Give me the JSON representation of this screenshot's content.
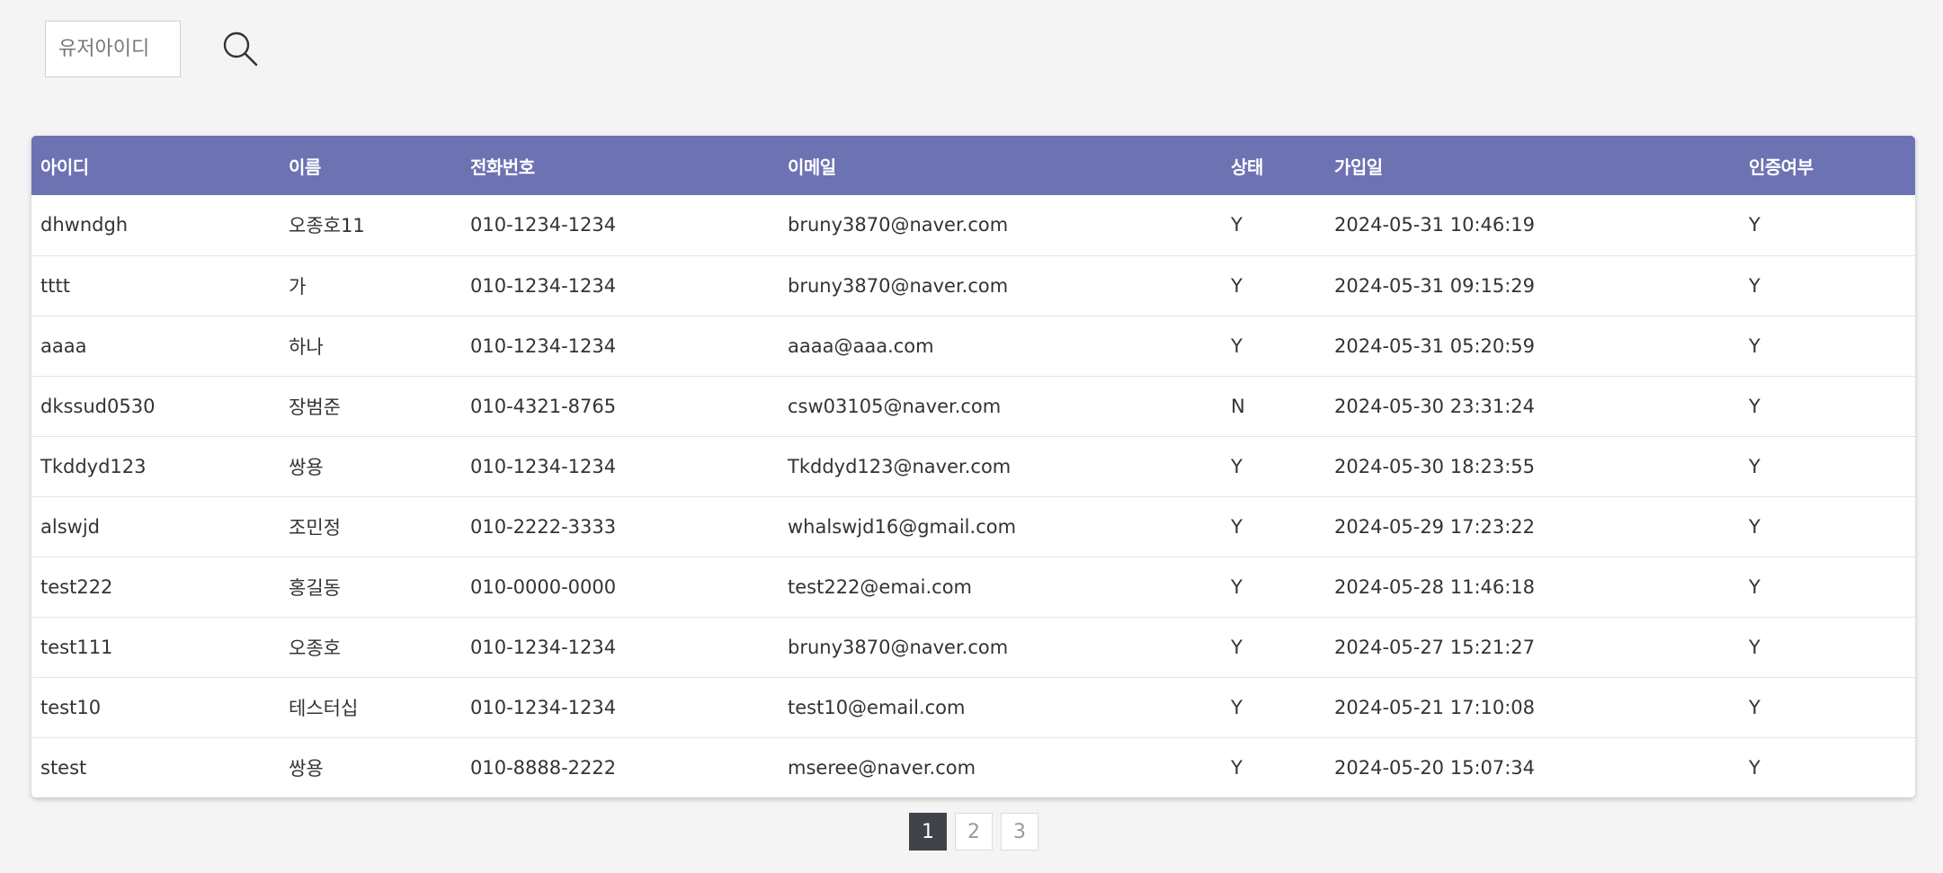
{
  "search": {
    "placeholder": "유저아이디",
    "value": ""
  },
  "table": {
    "headers": [
      "아이디",
      "이름",
      "전화번호",
      "이메일",
      "상태",
      "가입일",
      "인증여부"
    ],
    "rows": [
      [
        "dhwndgh",
        "오종호11",
        "010-1234-1234",
        "bruny3870@naver.com",
        "Y",
        "2024-05-31 10:46:19",
        "Y"
      ],
      [
        "tttt",
        "가",
        "010-1234-1234",
        "bruny3870@naver.com",
        "Y",
        "2024-05-31 09:15:29",
        "Y"
      ],
      [
        "aaaa",
        "하나",
        "010-1234-1234",
        "aaaa@aaa.com",
        "Y",
        "2024-05-31 05:20:59",
        "Y"
      ],
      [
        "dkssud0530",
        "장범준",
        "010-4321-8765",
        "csw03105@naver.com",
        "N",
        "2024-05-30 23:31:24",
        "Y"
      ],
      [
        "Tkddyd123",
        "쌍용",
        "010-1234-1234",
        "Tkddyd123@naver.com",
        "Y",
        "2024-05-30 18:23:55",
        "Y"
      ],
      [
        "alswjd",
        "조민정",
        "010-2222-3333",
        "whalswjd16@gmail.com",
        "Y",
        "2024-05-29 17:23:22",
        "Y"
      ],
      [
        "test222",
        "홍길동",
        "010-0000-0000",
        "test222@emai.com",
        "Y",
        "2024-05-28 11:46:18",
        "Y"
      ],
      [
        "test111",
        "오종호",
        "010-1234-1234",
        "bruny3870@naver.com",
        "Y",
        "2024-05-27 15:21:27",
        "Y"
      ],
      [
        "test10",
        "테스터십",
        "010-1234-1234",
        "test10@email.com",
        "Y",
        "2024-05-21 17:10:08",
        "Y"
      ],
      [
        "stest",
        "쌍용",
        "010-8888-2222",
        "mseree@naver.com",
        "Y",
        "2024-05-20 15:07:34",
        "Y"
      ]
    ]
  },
  "pagination": {
    "pages": [
      "1",
      "2",
      "3"
    ],
    "current": "1"
  },
  "colors": {
    "header_bg": "#6c72b2",
    "active_page_bg": "#3f434a",
    "page_bg": "#f4f4f4"
  },
  "icons": {
    "search": "search-icon"
  }
}
